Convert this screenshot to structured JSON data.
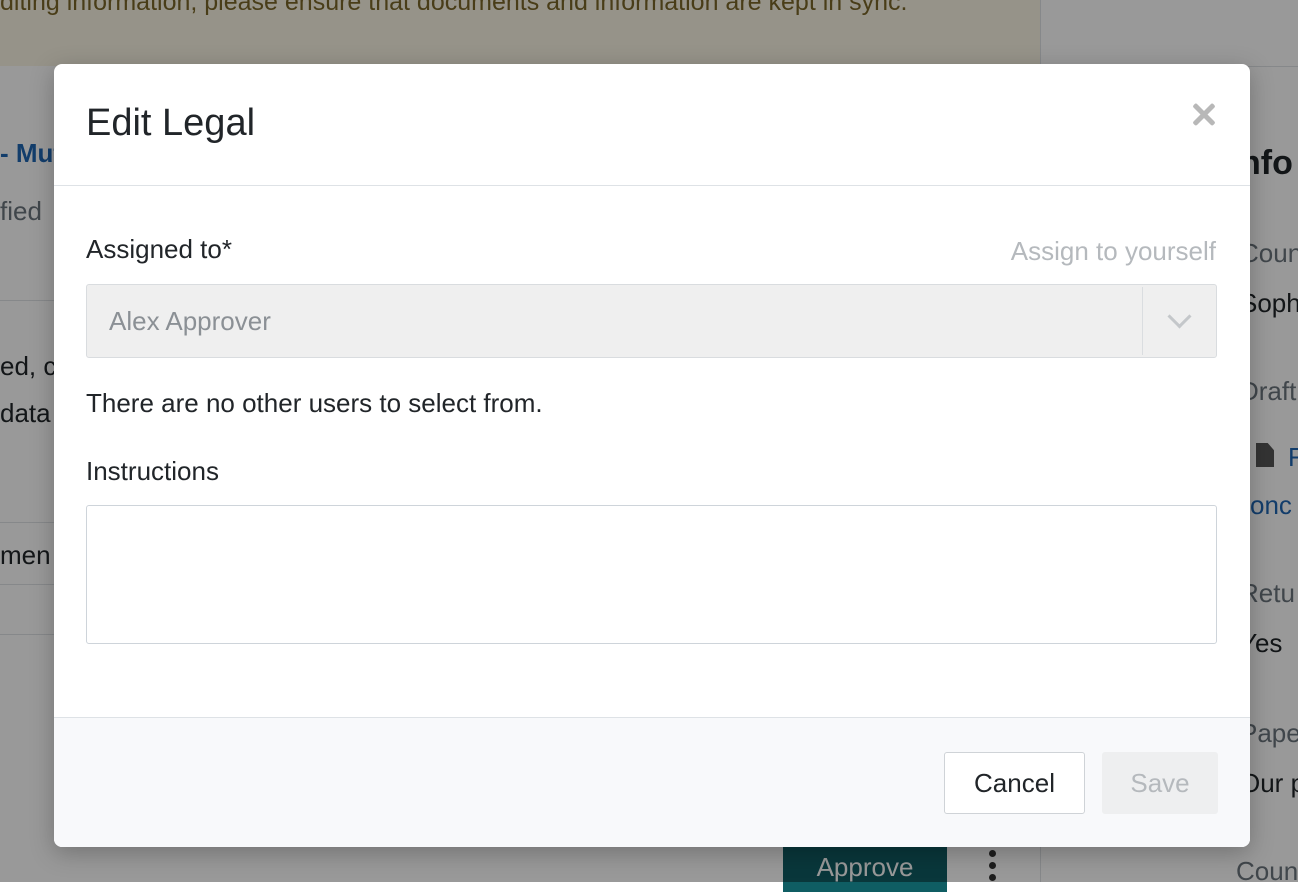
{
  "background": {
    "banner_text": "diting information, please ensure that documents and information are kept in sync.",
    "left_fragments": [
      "- Mut",
      "fied",
      "ed, cl",
      "data",
      "men"
    ],
    "right_fragments": [
      "nfo",
      "Coun",
      "Soph",
      "Draft",
      "F",
      "onc",
      "Retu",
      "Yes",
      "Pape",
      "Our p",
      "Coun"
    ],
    "approve_label": "Approve"
  },
  "modal": {
    "title": "Edit Legal",
    "assigned_label": "Assigned to*",
    "assign_yourself": "Assign to yourself",
    "assigned_value": "Alex Approver",
    "help_text": "There are no other users to select from.",
    "instructions_label": "Instructions",
    "instructions_value": "",
    "cancel_label": "Cancel",
    "save_label": "Save"
  },
  "icons": {
    "close": "close-icon",
    "dropdown": "chevron-down-icon",
    "document": "document-icon",
    "more": "kebab-menu-icon"
  }
}
